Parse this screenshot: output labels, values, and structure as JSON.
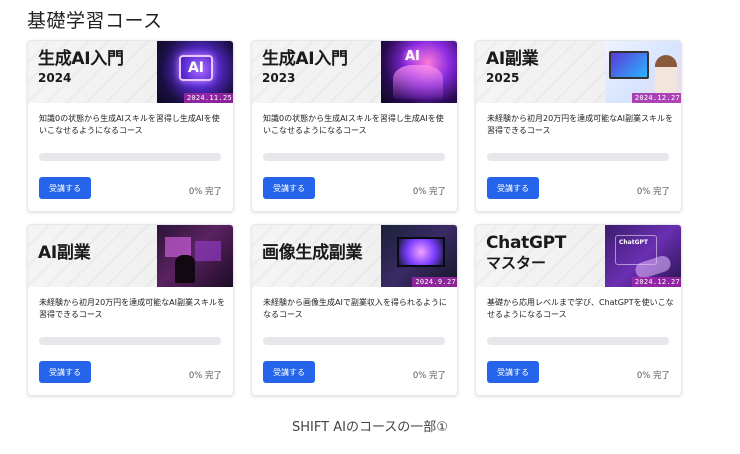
{
  "section_title": "基礎学習コース",
  "caption": "SHIFT AIのコースの一部①",
  "colors": {
    "button": "#2563eb",
    "progress_track": "#e5e7eb",
    "date_badge": "#a028aa"
  },
  "courses": [
    {
      "title_line1": "生成AI入門",
      "title_line2": "2024",
      "thumb_text": "AI",
      "date": "2024.11.25",
      "description": "知識0の状態から生成AIスキルを習得し生成AIを使いこなせるようになるコース",
      "progress": 0,
      "button_label": "受講する",
      "status": "0% 完了"
    },
    {
      "title_line1": "生成AI入門",
      "title_line2": "2023",
      "thumb_text": "AI",
      "date": "",
      "description": "知識0の状態から生成AIスキルを習得し生成AIを使いこなせるようになるコース",
      "progress": 0,
      "button_label": "受講する",
      "status": "0% 完了"
    },
    {
      "title_line1": "AI副業",
      "title_line2": "2025",
      "thumb_text": "",
      "date": "2024.12.27",
      "description": "未経験から初月20万円を達成可能なAI副業スキルを習得できるコース",
      "progress": 0,
      "button_label": "受講する",
      "status": "0% 完了"
    },
    {
      "title_line1": "AI副業",
      "title_line2": "",
      "thumb_text": "",
      "date": "",
      "description": "未経験から初月20万円を達成可能なAI副業スキルを習得できるコース",
      "progress": 0,
      "button_label": "受講する",
      "status": "0% 完了"
    },
    {
      "title_line1": "画像生成副業",
      "title_line2": "",
      "thumb_text": "",
      "date": "2024.9.27",
      "description": "未経験から画像生成AIで副業収入を得られるようになるコース",
      "progress": 0,
      "button_label": "受講する",
      "status": "0% 完了"
    },
    {
      "title_line1": "ChatGPT",
      "title_line2": "マスター",
      "thumb_text": "ChatGPT",
      "date": "2024.12.27",
      "description": "基礎から応用レベルまで学び、ChatGPTを使いこなせるようになるコース",
      "progress": 0,
      "button_label": "受講する",
      "status": "0% 完了"
    }
  ]
}
